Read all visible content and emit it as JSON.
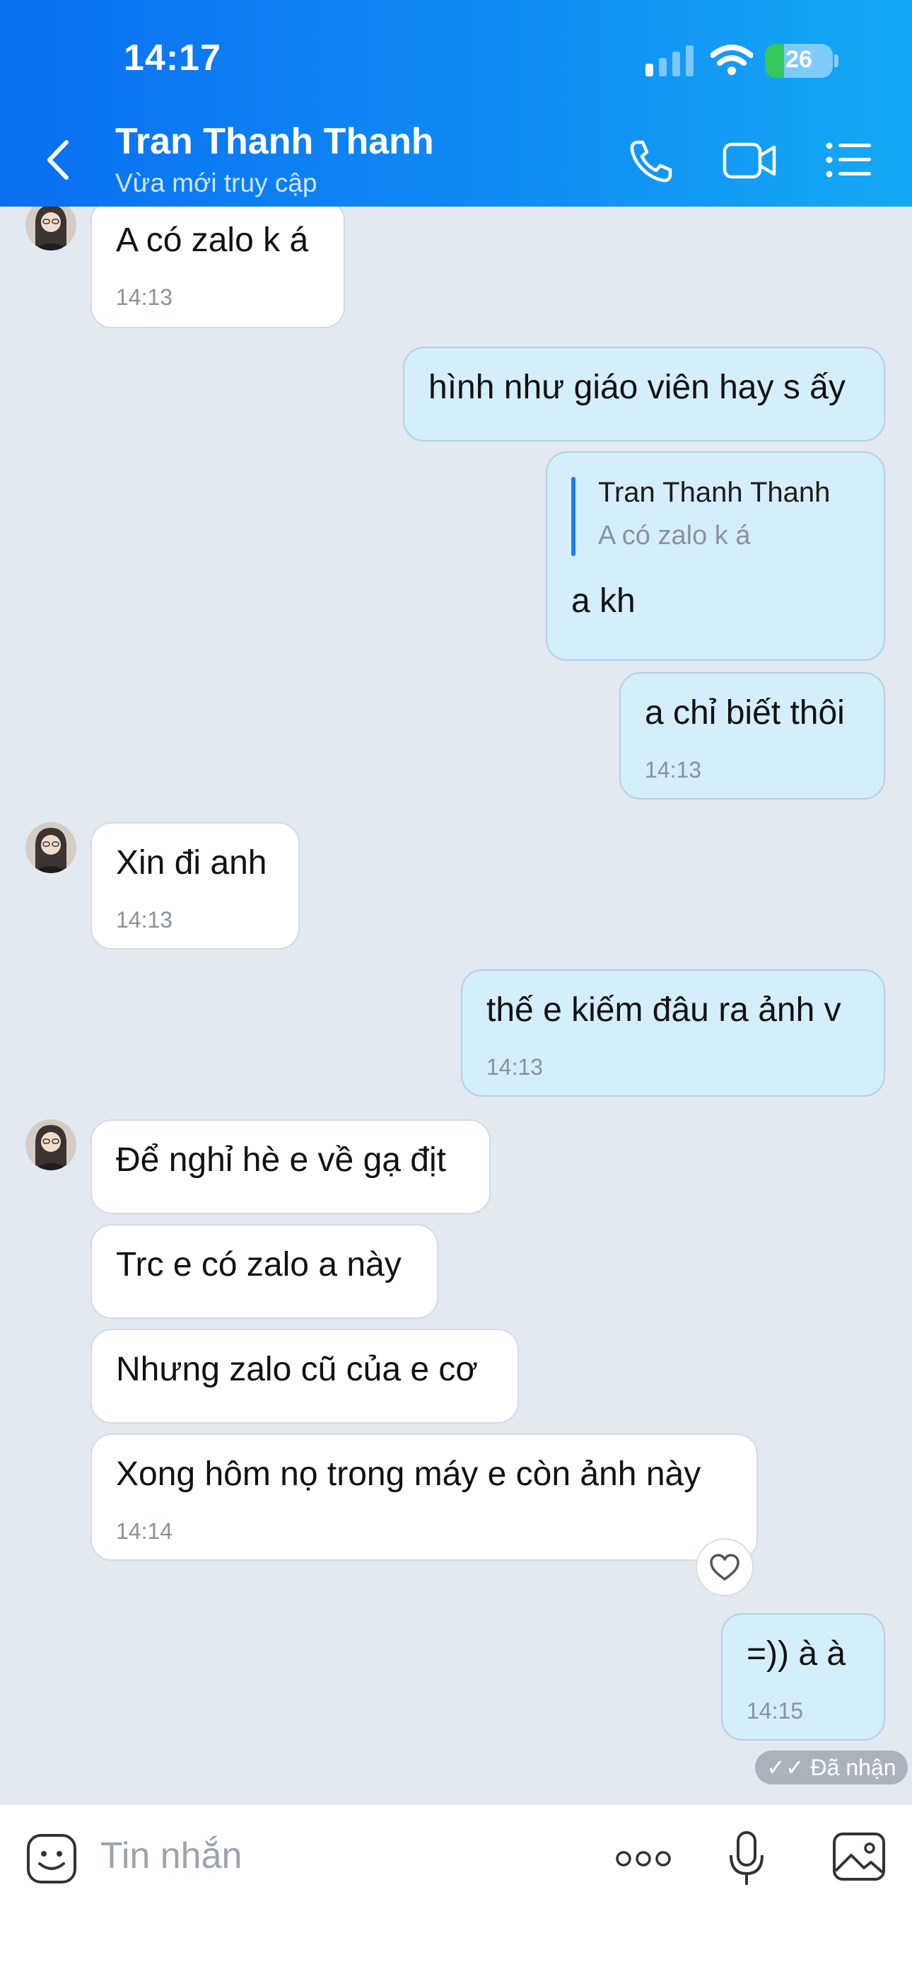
{
  "status_bar": {
    "time": "14:17",
    "battery": "26"
  },
  "header": {
    "title": "Tran Thanh Thanh",
    "subtitle": "Vừa mới truy cập",
    "icons": [
      "back-icon",
      "phone-icon",
      "video-icon",
      "menu-icon"
    ]
  },
  "messages": [
    {
      "from": "contact",
      "text": "A có zalo k á",
      "time": "14:13"
    },
    {
      "from": "me",
      "text": "hình như giáo viên hay s ấy"
    },
    {
      "from": "me",
      "reply_to": {
        "name": "Tran Thanh Thanh",
        "text": "A có zalo k á"
      },
      "text": "a kh"
    },
    {
      "from": "me",
      "text": "a chỉ biết thôi",
      "time": "14:13"
    },
    {
      "from": "contact",
      "text": "Xin đi anh",
      "time": "14:13"
    },
    {
      "from": "me",
      "text": "thế e kiếm đâu ra ảnh v",
      "time": "14:13"
    },
    {
      "from": "contact",
      "text": "Để nghỉ hè e về gạ địt"
    },
    {
      "from": "contact",
      "text": "Trc e có zalo a này"
    },
    {
      "from": "contact",
      "text": "Nhưng zalo cũ của e cơ"
    },
    {
      "from": "contact",
      "text": "Xong hôm nọ trong máy e còn ảnh này",
      "time": "14:14"
    },
    {
      "from": "me",
      "text": "=)) à à",
      "time": "14:15"
    }
  ],
  "delivery_status": "Đã nhận",
  "composer": {
    "placeholder": "Tin nhắn",
    "icons": [
      "sticker-icon",
      "more-icon",
      "microphone-icon",
      "image-icon"
    ]
  },
  "colors": {
    "header_start": "#0a6ff0",
    "header_end": "#14a9f4",
    "background": "#e2e9f1",
    "incoming_bubble": "#ffffff",
    "outgoing_bubble": "#d4eefc",
    "quote_bar": "#1c7bf2"
  }
}
